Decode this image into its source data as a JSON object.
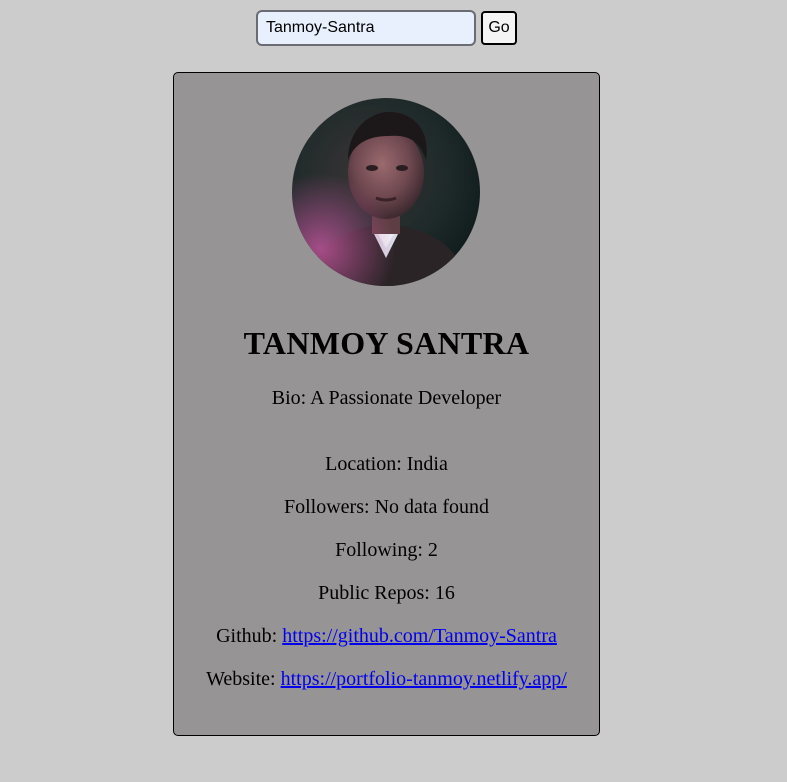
{
  "search": {
    "value": "Tanmoy-Santra",
    "go_label": "Go"
  },
  "profile": {
    "name": "TANMOY SANTRA",
    "bio_label": "Bio: ",
    "bio": "A Passionate Developer",
    "location_label": "Location: ",
    "location": "India",
    "followers_label": "Followers: ",
    "followers": "No data found",
    "following_label": "Following: ",
    "following": "2",
    "repos_label": "Public Repos: ",
    "repos": "16",
    "github_label": "Github: ",
    "github_url": "https://github.com/Tanmoy-Santra",
    "website_label": "Website: ",
    "website_url": "https://portfolio-tanmoy.netlify.app/"
  },
  "colors": {
    "page_bg": "#cccccc",
    "card_bg": "#969494",
    "link": "#0000ee",
    "input_bg": "#e8f0fe"
  }
}
